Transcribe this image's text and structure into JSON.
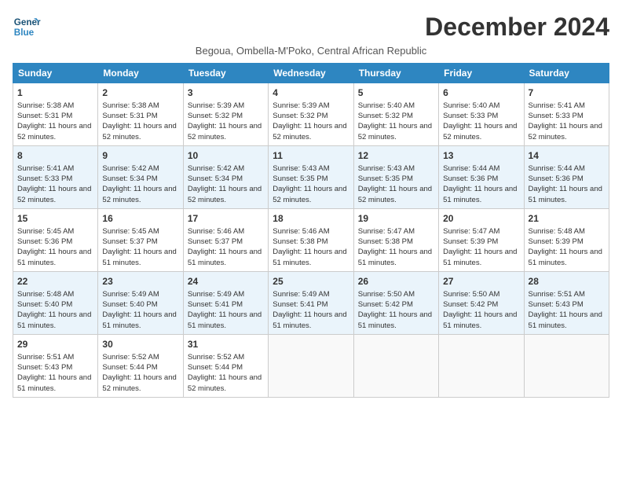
{
  "logo": {
    "line1": "General",
    "line2": "Blue"
  },
  "title": "December 2024",
  "subtitle": "Begoua, Ombella-M'Poko, Central African Republic",
  "days_of_week": [
    "Sunday",
    "Monday",
    "Tuesday",
    "Wednesday",
    "Thursday",
    "Friday",
    "Saturday"
  ],
  "weeks": [
    [
      {
        "day": "1",
        "sunrise": "5:38 AM",
        "sunset": "5:31 PM",
        "daylight": "11 hours and 52 minutes."
      },
      {
        "day": "2",
        "sunrise": "5:38 AM",
        "sunset": "5:31 PM",
        "daylight": "11 hours and 52 minutes."
      },
      {
        "day": "3",
        "sunrise": "5:39 AM",
        "sunset": "5:32 PM",
        "daylight": "11 hours and 52 minutes."
      },
      {
        "day": "4",
        "sunrise": "5:39 AM",
        "sunset": "5:32 PM",
        "daylight": "11 hours and 52 minutes."
      },
      {
        "day": "5",
        "sunrise": "5:40 AM",
        "sunset": "5:32 PM",
        "daylight": "11 hours and 52 minutes."
      },
      {
        "day": "6",
        "sunrise": "5:40 AM",
        "sunset": "5:33 PM",
        "daylight": "11 hours and 52 minutes."
      },
      {
        "day": "7",
        "sunrise": "5:41 AM",
        "sunset": "5:33 PM",
        "daylight": "11 hours and 52 minutes."
      }
    ],
    [
      {
        "day": "8",
        "sunrise": "5:41 AM",
        "sunset": "5:33 PM",
        "daylight": "11 hours and 52 minutes."
      },
      {
        "day": "9",
        "sunrise": "5:42 AM",
        "sunset": "5:34 PM",
        "daylight": "11 hours and 52 minutes."
      },
      {
        "day": "10",
        "sunrise": "5:42 AM",
        "sunset": "5:34 PM",
        "daylight": "11 hours and 52 minutes."
      },
      {
        "day": "11",
        "sunrise": "5:43 AM",
        "sunset": "5:35 PM",
        "daylight": "11 hours and 52 minutes."
      },
      {
        "day": "12",
        "sunrise": "5:43 AM",
        "sunset": "5:35 PM",
        "daylight": "11 hours and 52 minutes."
      },
      {
        "day": "13",
        "sunrise": "5:44 AM",
        "sunset": "5:36 PM",
        "daylight": "11 hours and 51 minutes."
      },
      {
        "day": "14",
        "sunrise": "5:44 AM",
        "sunset": "5:36 PM",
        "daylight": "11 hours and 51 minutes."
      }
    ],
    [
      {
        "day": "15",
        "sunrise": "5:45 AM",
        "sunset": "5:36 PM",
        "daylight": "11 hours and 51 minutes."
      },
      {
        "day": "16",
        "sunrise": "5:45 AM",
        "sunset": "5:37 PM",
        "daylight": "11 hours and 51 minutes."
      },
      {
        "day": "17",
        "sunrise": "5:46 AM",
        "sunset": "5:37 PM",
        "daylight": "11 hours and 51 minutes."
      },
      {
        "day": "18",
        "sunrise": "5:46 AM",
        "sunset": "5:38 PM",
        "daylight": "11 hours and 51 minutes."
      },
      {
        "day": "19",
        "sunrise": "5:47 AM",
        "sunset": "5:38 PM",
        "daylight": "11 hours and 51 minutes."
      },
      {
        "day": "20",
        "sunrise": "5:47 AM",
        "sunset": "5:39 PM",
        "daylight": "11 hours and 51 minutes."
      },
      {
        "day": "21",
        "sunrise": "5:48 AM",
        "sunset": "5:39 PM",
        "daylight": "11 hours and 51 minutes."
      }
    ],
    [
      {
        "day": "22",
        "sunrise": "5:48 AM",
        "sunset": "5:40 PM",
        "daylight": "11 hours and 51 minutes."
      },
      {
        "day": "23",
        "sunrise": "5:49 AM",
        "sunset": "5:40 PM",
        "daylight": "11 hours and 51 minutes."
      },
      {
        "day": "24",
        "sunrise": "5:49 AM",
        "sunset": "5:41 PM",
        "daylight": "11 hours and 51 minutes."
      },
      {
        "day": "25",
        "sunrise": "5:49 AM",
        "sunset": "5:41 PM",
        "daylight": "11 hours and 51 minutes."
      },
      {
        "day": "26",
        "sunrise": "5:50 AM",
        "sunset": "5:42 PM",
        "daylight": "11 hours and 51 minutes."
      },
      {
        "day": "27",
        "sunrise": "5:50 AM",
        "sunset": "5:42 PM",
        "daylight": "11 hours and 51 minutes."
      },
      {
        "day": "28",
        "sunrise": "5:51 AM",
        "sunset": "5:43 PM",
        "daylight": "11 hours and 51 minutes."
      }
    ],
    [
      {
        "day": "29",
        "sunrise": "5:51 AM",
        "sunset": "5:43 PM",
        "daylight": "11 hours and 51 minutes."
      },
      {
        "day": "30",
        "sunrise": "5:52 AM",
        "sunset": "5:44 PM",
        "daylight": "11 hours and 52 minutes."
      },
      {
        "day": "31",
        "sunrise": "5:52 AM",
        "sunset": "5:44 PM",
        "daylight": "11 hours and 52 minutes."
      },
      null,
      null,
      null,
      null
    ]
  ]
}
